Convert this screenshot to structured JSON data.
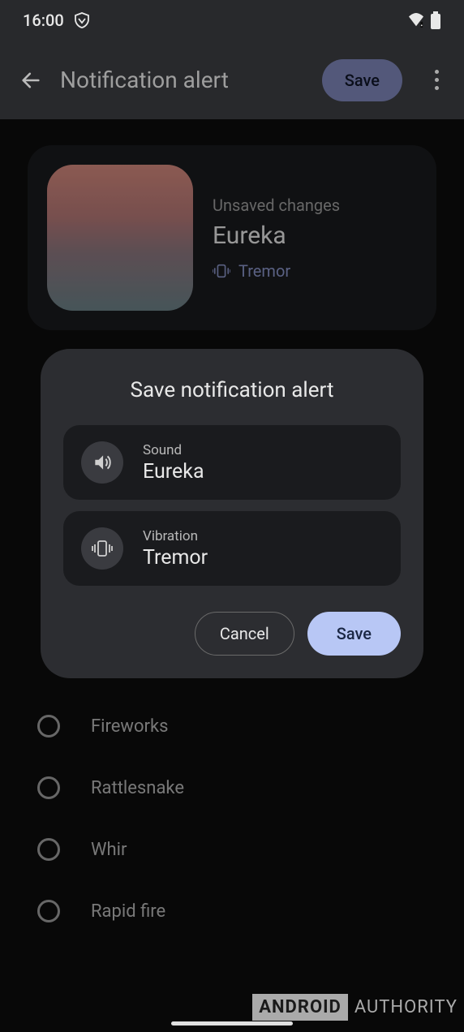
{
  "status": {
    "time": "16:00"
  },
  "appbar": {
    "title": "Notification alert",
    "save_label": "Save"
  },
  "preview": {
    "status": "Unsaved changes",
    "name": "Eureka",
    "vibration": "Tremor"
  },
  "sounds": {
    "items": [
      {
        "label": "Fireworks"
      },
      {
        "label": "Rattlesnake"
      },
      {
        "label": "Whir"
      },
      {
        "label": "Rapid fire"
      }
    ]
  },
  "dialog": {
    "title": "Save notification alert",
    "sound_label": "Sound",
    "sound_value": "Eureka",
    "vibration_label": "Vibration",
    "vibration_value": "Tremor",
    "cancel_label": "Cancel",
    "save_label": "Save"
  },
  "watermark": {
    "brand1": "ANDROID",
    "brand2": "AUTHORITY"
  }
}
